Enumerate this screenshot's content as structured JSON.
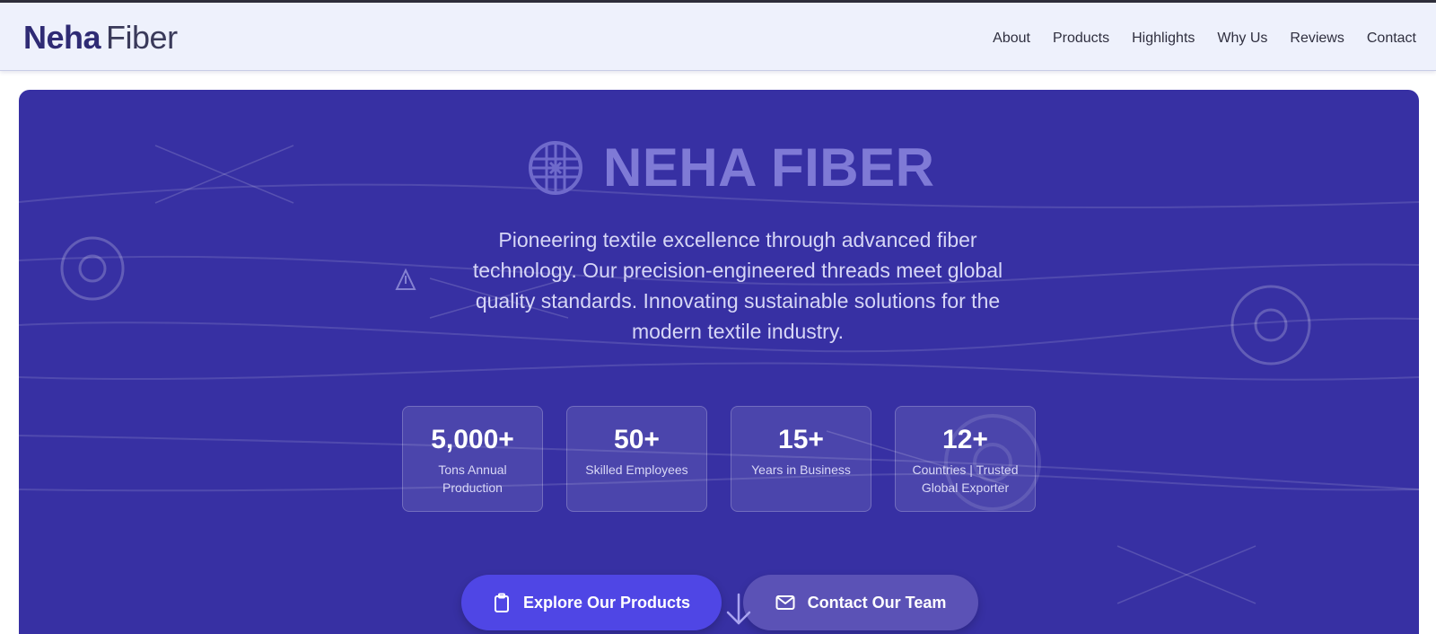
{
  "brand": {
    "bold": "Neha",
    "light": "Fiber"
  },
  "nav": {
    "items": [
      {
        "label": "About"
      },
      {
        "label": "Products"
      },
      {
        "label": "Highlights"
      },
      {
        "label": "Why Us"
      },
      {
        "label": "Reviews"
      },
      {
        "label": "Contact"
      }
    ]
  },
  "hero": {
    "title": "NEHA FIBER",
    "title_icon": "globe-fiber-icon",
    "description": "Pioneering textile excellence through advanced fiber technology. Our precision-engineered threads meet global quality standards. Innovating sustainable solutions for the modern textile industry.",
    "stats": [
      {
        "value": "5,000+",
        "label": "Tons Annual Production"
      },
      {
        "value": "50+",
        "label": "Skilled Employees"
      },
      {
        "value": "15+",
        "label": "Years in Business"
      },
      {
        "value": "12+",
        "label": "Countries | Trusted Global Exporter"
      }
    ],
    "buttons": {
      "primary": {
        "label": "Explore Our Products",
        "icon": "clipboard-icon"
      },
      "secondary": {
        "label": "Contact Our Team",
        "icon": "mail-icon"
      }
    },
    "scroll_icon": "arrow-down-icon"
  },
  "colors": {
    "hero_bg": "#3730a3",
    "nav_bg": "#eef1fc",
    "brand_text": "#2f2b74",
    "primary_button": "#4f46e5",
    "secondary_button": "#5b52b6",
    "title_text": "#7f7ad6"
  }
}
